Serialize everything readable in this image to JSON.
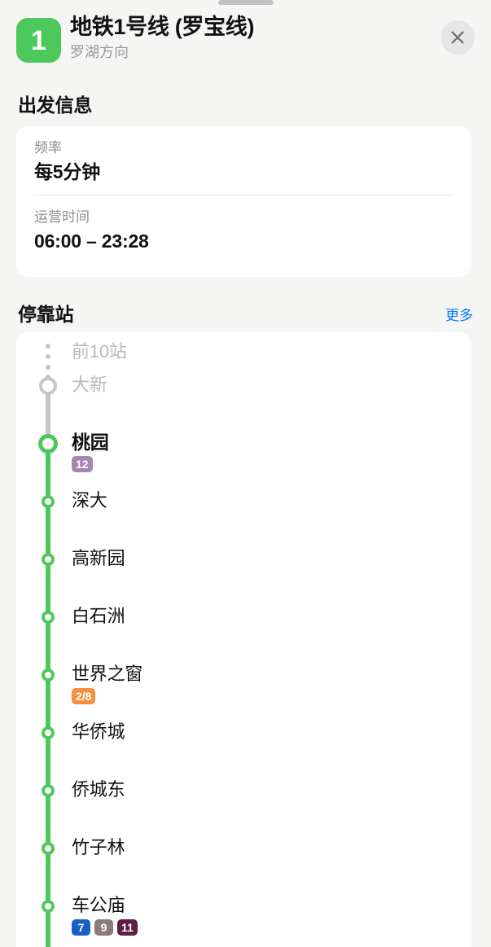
{
  "sheet": {
    "drag_handle": "drag-handle"
  },
  "header": {
    "line_number": "1",
    "line_badge_color": "#4dc95b",
    "title": "地铁1号线 (罗宝线)",
    "subtitle": "罗湖方向",
    "close_label": "✕"
  },
  "departure": {
    "section_title": "出发信息",
    "rows": [
      {
        "label": "频率",
        "value": "每5分钟"
      },
      {
        "label": "运营时间",
        "value": "06:00 – 23:28"
      }
    ]
  },
  "stops": {
    "section_title": "停靠站",
    "more_label": "更多",
    "more_color": "#0a7aff",
    "line_color": "#4dc95b",
    "dim_color": "#c6c6c8",
    "collapsed_label": "前10站",
    "items": [
      {
        "name": "大新",
        "state": "dim",
        "marker": "ring-dim",
        "badges": []
      },
      {
        "name": "桃园",
        "state": "current",
        "marker": "ring-major",
        "badges": [
          {
            "label": "12",
            "color": "#a787b0"
          }
        ]
      },
      {
        "name": "深大",
        "state": "normal",
        "marker": "ring-minor",
        "badges": []
      },
      {
        "name": "高新园",
        "state": "normal",
        "marker": "ring-minor",
        "badges": []
      },
      {
        "name": "白石洲",
        "state": "normal",
        "marker": "ring-minor",
        "badges": []
      },
      {
        "name": "世界之窗",
        "state": "normal",
        "marker": "ring-minor",
        "badges": [
          {
            "label": "2/8",
            "color": "#f5913e"
          }
        ]
      },
      {
        "name": "华侨城",
        "state": "normal",
        "marker": "ring-minor",
        "badges": []
      },
      {
        "name": "侨城东",
        "state": "normal",
        "marker": "ring-minor",
        "badges": []
      },
      {
        "name": "竹子林",
        "state": "normal",
        "marker": "ring-minor",
        "badges": []
      },
      {
        "name": "车公庙",
        "state": "normal",
        "marker": "ring-minor",
        "badges": [
          {
            "label": "7",
            "color": "#1a5fc4"
          },
          {
            "label": "9",
            "color": "#8a7a7a"
          },
          {
            "label": "11",
            "color": "#5e1f40"
          }
        ]
      }
    ]
  }
}
